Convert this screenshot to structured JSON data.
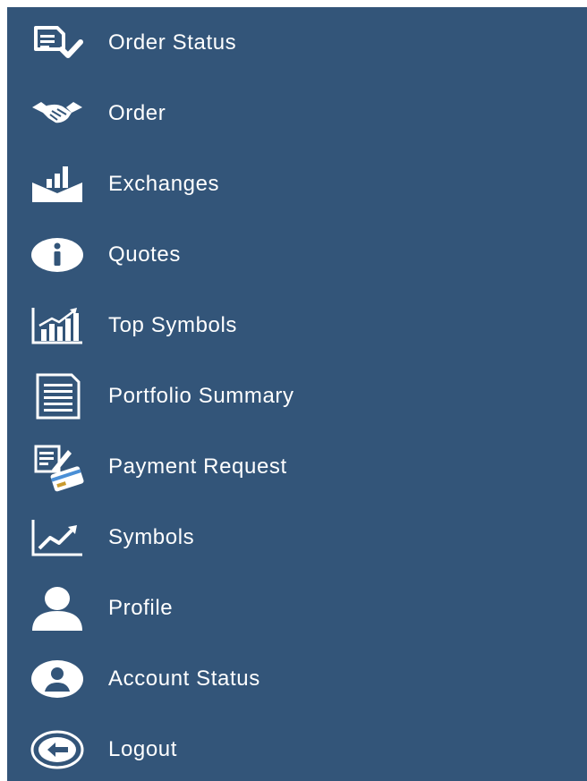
{
  "menu": {
    "background_color": "#335579",
    "icon_color": "#ffffff",
    "items": [
      {
        "label": "Order Status",
        "icon": "order-status-icon"
      },
      {
        "label": "Order",
        "icon": "handshake-icon"
      },
      {
        "label": "Exchanges",
        "icon": "exchange-chart-icon"
      },
      {
        "label": "Quotes",
        "icon": "info-icon"
      },
      {
        "label": "Top Symbols",
        "icon": "bar-chart-icon"
      },
      {
        "label": "Portfolio Summary",
        "icon": "document-icon"
      },
      {
        "label": "Payment Request",
        "icon": "payment-card-icon"
      },
      {
        "label": "Symbols",
        "icon": "line-chart-icon"
      },
      {
        "label": "Profile",
        "icon": "user-icon"
      },
      {
        "label": "Account Status",
        "icon": "account-circle-icon"
      },
      {
        "label": "Logout",
        "icon": "logout-icon"
      }
    ]
  }
}
